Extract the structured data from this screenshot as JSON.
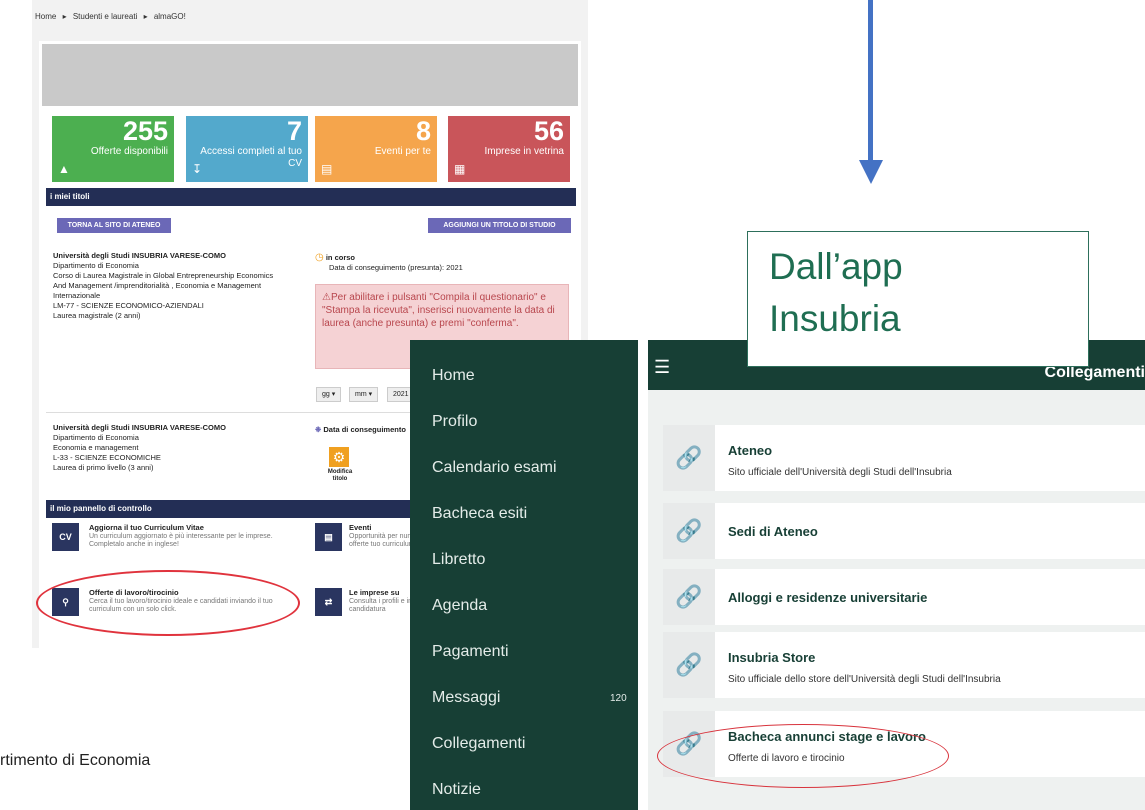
{
  "breadcrumb": [
    "Home",
    "▸",
    "Studenti e laureati",
    "▸",
    "almaGO!"
  ],
  "tiles": [
    {
      "number": "255",
      "label": "Offerte disponibili",
      "color": "#4caf50",
      "icon": "megaphone-icon"
    },
    {
      "number": "7",
      "label": "Accessi completi al tuo CV",
      "color": "#53a9cc",
      "icon": "download-icon"
    },
    {
      "number": "8",
      "label": "Eventi per te",
      "color": "#f5a54c",
      "icon": "calendar-icon"
    },
    {
      "number": "56",
      "label": "Imprese in vetrina",
      "color": "#c9555a",
      "icon": "building-icon"
    }
  ],
  "titoli": {
    "header": "i miei titoli",
    "back_button": "TORNA AL SITO DI ATENEO",
    "add_button": "AGGIUNGI UN TITOLO DI STUDIO",
    "first": {
      "university": "Università degli Studi INSUBRIA VARESE-COMO",
      "lines": [
        "Dipartimento di Economia",
        "Corso di Laurea Magistrale in Global Entrepreneurship Economics",
        "And Management /imprenditorialità , Economia e Management",
        "Internazionale",
        "LM-77 - SCIENZE ECONOMICO-AZIENDALI",
        "Laurea magistrale (2 anni)"
      ],
      "status": "in corso",
      "date": "Data di conseguimento (presunta): 2021",
      "warning": "⚠Per abilitare i pulsanti \"Compila il questionario\" e \"Stampa la ricevuta\", inserisci nuovamente la data di laurea (anche presunta) e premi \"conferma\".",
      "sel_day": "gg",
      "sel_month": "mm",
      "sel_year": "2021"
    },
    "second": {
      "university": "Università degli Studi INSUBRIA VARESE-COMO",
      "lines": [
        "Dipartimento di Economia",
        "Economia e management",
        "L-33 - SCIENZE ECONOMICHE",
        "Laurea di primo livello (3 anni)"
      ],
      "date": "Data di conseguimento",
      "modify": "Modifica titolo"
    }
  },
  "pannello": {
    "header": "il mio pannello di controllo",
    "cv_title": "Aggiorna il tuo Curriculum Vitae",
    "cv_desc": "Un curriculum aggiornato è più interessante per le imprese. Completalo anche in inglese!",
    "ev_title": "Eventi",
    "ev_desc": "Opportunità per numerose offerte tuo curriculum",
    "job_title": "Offerte di lavoro/tirocinio",
    "job_desc": "Cerca il tuo lavoro/tirocinio ideale e candidati inviando il tuo curriculum con un solo click.",
    "imp_title": "Le imprese su",
    "imp_desc": "Consulta i profili e invia la tua candidatura"
  },
  "callout": {
    "line1": "Dall’app",
    "line2": "Insubria"
  },
  "app": {
    "nav": [
      "Home",
      "Profilo",
      "Calendario esami",
      "Bacheca esiti",
      "Libretto",
      "Agenda",
      "Pagamenti",
      "Messaggi",
      "Collegamenti",
      "Notizie"
    ],
    "messages_badge": "120",
    "title": "Collegamenti",
    "links": [
      {
        "title": "Ateneo",
        "subtitle": "Sito ufficiale dell'Università degli Studi dell'Insubria"
      },
      {
        "title": "Sedi di Ateneo",
        "subtitle": ""
      },
      {
        "title": "Alloggi e residenze universitarie",
        "subtitle": ""
      },
      {
        "title": "Insubria Store",
        "subtitle": "Sito ufficiale dello store dell'Università degli Studi dell'Insubria"
      },
      {
        "title": "Bacheca annunci stage e lavoro",
        "subtitle": "Offerte di lavoro e tirocinio"
      }
    ]
  },
  "bottom_text": "rtimento di Economia"
}
